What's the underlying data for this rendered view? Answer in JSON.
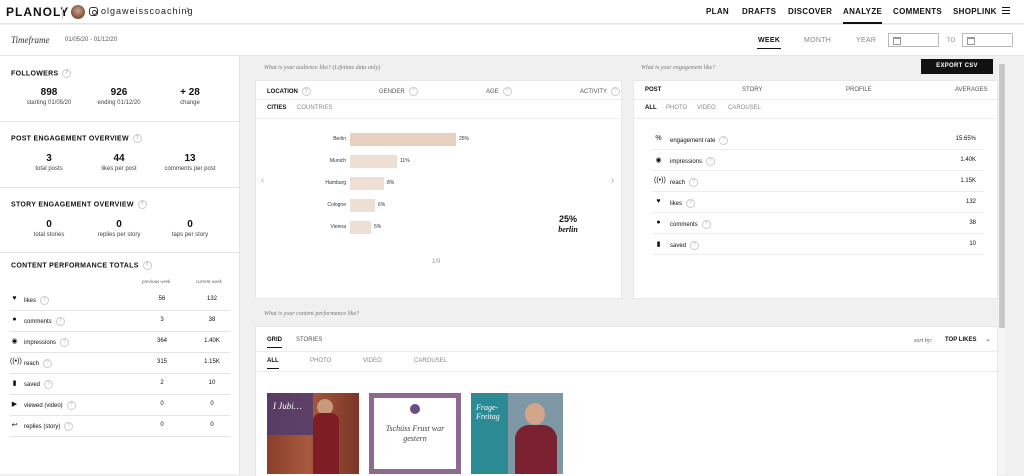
{
  "topnav": {
    "logo": "PLANOLY",
    "account": "olgaweisscoaching",
    "nav": [
      "PLAN",
      "DRAFTS",
      "DISCOVER",
      "ANALYZE",
      "COMMENTS",
      "SHOPLINK"
    ]
  },
  "timeframe": {
    "label": "Timeframe",
    "range": "01/05/20 - 01/12/20",
    "tabs": [
      "WEEK",
      "MONTH",
      "YEAR"
    ],
    "to": "TO"
  },
  "sidebar": {
    "followers": {
      "title": "FOLLOWERS",
      "stats": [
        {
          "value": "898",
          "label": "starting 01/05/20"
        },
        {
          "value": "926",
          "label": "ending 01/12/20"
        },
        {
          "value": "+ 28",
          "label": "change"
        }
      ]
    },
    "post_engagement": {
      "title": "POST ENGAGEMENT OVERVIEW",
      "stats": [
        {
          "value": "3",
          "label": "total posts"
        },
        {
          "value": "44",
          "label": "likes per post"
        },
        {
          "value": "13",
          "label": "comments per post"
        }
      ]
    },
    "story_engagement": {
      "title": "STORY ENGAGEMENT OVERVIEW",
      "stats": [
        {
          "value": "0",
          "label": "total stories"
        },
        {
          "value": "0",
          "label": "replies per story"
        },
        {
          "value": "0",
          "label": "taps per story"
        }
      ]
    },
    "content_performance": {
      "title": "CONTENT PERFORMANCE TOTALS",
      "col_prev": "previous week",
      "col_curr": "current week",
      "rows": [
        {
          "icon": "heart-icon",
          "glyph": "♥",
          "name": "likes",
          "prev": "56",
          "curr": "132"
        },
        {
          "icon": "comment-icon",
          "glyph": "●",
          "name": "comments",
          "prev": "3",
          "curr": "38"
        },
        {
          "icon": "eye-icon",
          "glyph": "◉",
          "name": "impressions",
          "prev": "364",
          "curr": "1.40K"
        },
        {
          "icon": "reach-icon",
          "glyph": "((•))",
          "name": "reach",
          "prev": "315",
          "curr": "1.15K"
        },
        {
          "icon": "bookmark-icon",
          "glyph": "▮",
          "name": "saved",
          "prev": "2",
          "curr": "10"
        },
        {
          "icon": "play-icon",
          "glyph": "▶",
          "name": "viewed (video)",
          "prev": "0",
          "curr": "0"
        },
        {
          "icon": "reply-icon",
          "glyph": "↩",
          "name": "replies (story)",
          "prev": "0",
          "curr": "0"
        }
      ]
    }
  },
  "audience": {
    "question": "What is your audience like? (Lifetime data only)",
    "tabs": [
      "LOCATION",
      "GENDER",
      "AGE",
      "ACTIVITY"
    ],
    "subtabs": [
      "CITIES",
      "COUNTRIES"
    ],
    "page": "1/9",
    "highlight_pct": "25%",
    "highlight_city": "berlin"
  },
  "chart_data": {
    "type": "bar",
    "categories": [
      "Berlin",
      "Munich",
      "Hamburg",
      "Cologne",
      "Vienna"
    ],
    "values": [
      25,
      11,
      8,
      6,
      5
    ],
    "value_labels": [
      "25%",
      "11%",
      "8%",
      "6%",
      "5%"
    ]
  },
  "engagement": {
    "question": "What is your engagement like?",
    "export": "EXPORT CSV",
    "tabs": [
      "POST",
      "STORY",
      "PROFILE",
      "AVERAGES"
    ],
    "subtabs": [
      "ALL",
      "PHOTO",
      "VIDEO",
      "CAROUSEL"
    ],
    "rows": [
      {
        "icon": "percent-icon",
        "glyph": "%",
        "name": "engagement rate",
        "value": "15.65%"
      },
      {
        "icon": "eye-icon",
        "glyph": "◉",
        "name": "impressions",
        "value": "1.40K"
      },
      {
        "icon": "reach-icon",
        "glyph": "((•))",
        "name": "reach",
        "value": "1.15K"
      },
      {
        "icon": "heart-icon",
        "glyph": "♥",
        "name": "likes",
        "value": "132"
      },
      {
        "icon": "comment-icon",
        "glyph": "●",
        "name": "comments",
        "value": "38"
      },
      {
        "icon": "bookmark-icon",
        "glyph": "▮",
        "name": "saved",
        "value": "10"
      }
    ]
  },
  "content": {
    "question": "What is your content performance like?",
    "tabs": [
      "GRID",
      "STORIES"
    ],
    "subtabs": [
      "ALL",
      "PHOTO",
      "VIDEO",
      "CAROUSEL"
    ],
    "sort_label": "sort by:",
    "sort_value": "TOP LIKES",
    "thumbs": [
      {
        "text": "I Jubi…",
        "bg": "#7a3b2e"
      },
      {
        "text": "Tschüss Frust war gestern",
        "bg": "#ffffff"
      },
      {
        "text": "Frage-Freitag",
        "bg": "#2c8a94"
      }
    ]
  }
}
